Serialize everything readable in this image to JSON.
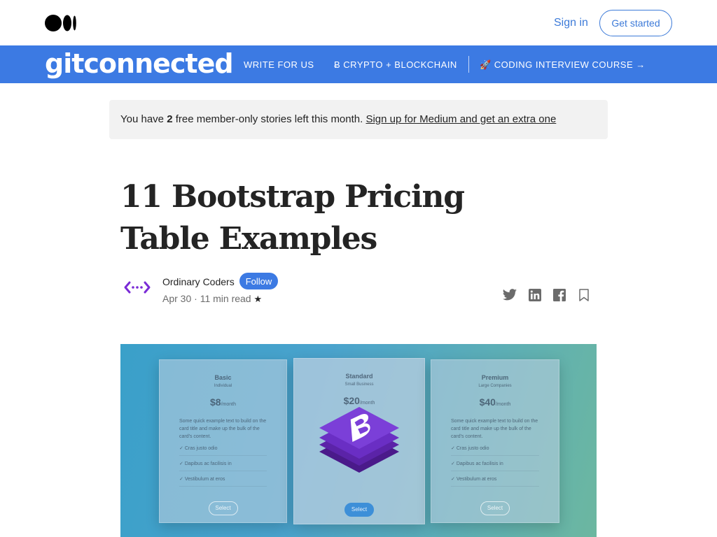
{
  "header": {
    "logo_icon": "medium-logo-icon",
    "signin_label": "Sign in",
    "getstarted_label": "Get started"
  },
  "publication": {
    "name": "gitconnected",
    "nav": [
      {
        "label": "WRITE FOR US"
      },
      {
        "label": "Ƀ CRYPTO + BLOCKCHAIN"
      },
      {
        "label": "🚀 CODING INTERVIEW COURSE →"
      }
    ],
    "color": "#3c7ae3"
  },
  "banner": {
    "prefix": "You have ",
    "count": "2",
    "middle": " free member-only stories left this month. ",
    "link": "Sign up for Medium and get an extra one"
  },
  "article": {
    "title": "11 Bootstrap Pricing Table Examples",
    "author": "Ordinary Coders",
    "follow_label": "Follow",
    "date": "Apr 30",
    "read_time": "11 min read",
    "member_star": "★",
    "share_icons": [
      "twitter-icon",
      "linkedin-icon",
      "facebook-icon",
      "bookmark-icon"
    ]
  },
  "hero": {
    "cards": [
      {
        "name": "Basic",
        "sub": "Individual",
        "price": "$8",
        "per": "/month",
        "desc": "Some quick example text to build on the card title and make up the bulk of the card's content.",
        "items": [
          "Cras justo odio",
          "Dapibus ac facilisis in",
          "Vestibulum at eros"
        ],
        "button": "Select"
      },
      {
        "name": "Standard",
        "sub": "Small Business",
        "price": "$20",
        "per": "/month",
        "desc": "",
        "items": [
          "",
          "",
          ""
        ],
        "button": "Select"
      },
      {
        "name": "Premium",
        "sub": "Large Companies",
        "price": "$40",
        "per": "/month",
        "desc": "Some quick example text to build on the card title and make up the bulk of the card's content.",
        "items": [
          "Cras justo odio",
          "Dapibus ac facilisis in",
          "Vestibulum at eros"
        ],
        "button": "Select"
      }
    ],
    "logo_icon": "bootstrap-logo-icon"
  }
}
